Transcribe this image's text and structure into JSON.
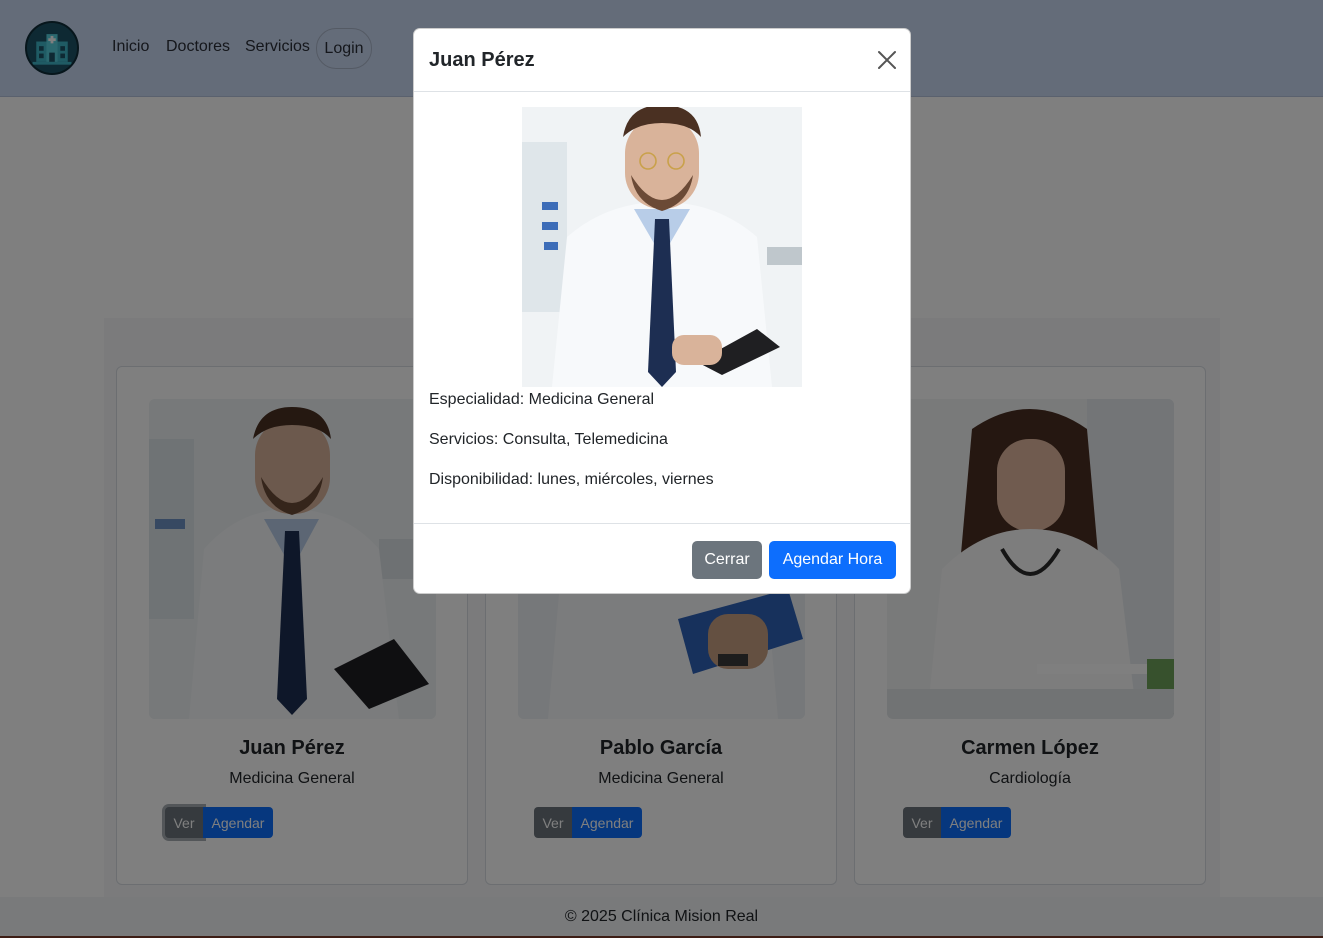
{
  "nav": {
    "logo_icon": "clinic-building-icon",
    "links": [
      "Inicio",
      "Doctores",
      "Servicios"
    ],
    "login": "Login"
  },
  "doctors": [
    {
      "name": "Juan Pérez",
      "specialty": "Medicina General",
      "view_label": "Ver",
      "schedule_label": "Agendar"
    },
    {
      "name": "Pablo García",
      "specialty": "Medicina General",
      "view_label": "Ver",
      "schedule_label": "Agendar"
    },
    {
      "name": "Carmen López",
      "specialty": "Cardiología",
      "view_label": "Ver",
      "schedule_label": "Agendar"
    }
  ],
  "footer": {
    "text": "© 2025 Clínica Mision Real"
  },
  "modal": {
    "title": "Juan Pérez",
    "close_icon": "close-icon",
    "specialty_line": "Especialidad: Medicina General",
    "services_line": "Servicios: Consulta, Telemedicina",
    "availability_line": "Disponibilidad: lunes, miércoles, viernes",
    "close_button": "Cerrar",
    "schedule_button": "Agendar Hora"
  },
  "colors": {
    "primary": "#0d6efd",
    "secondary": "#6c757d",
    "navbar": "#c9d8f3"
  }
}
